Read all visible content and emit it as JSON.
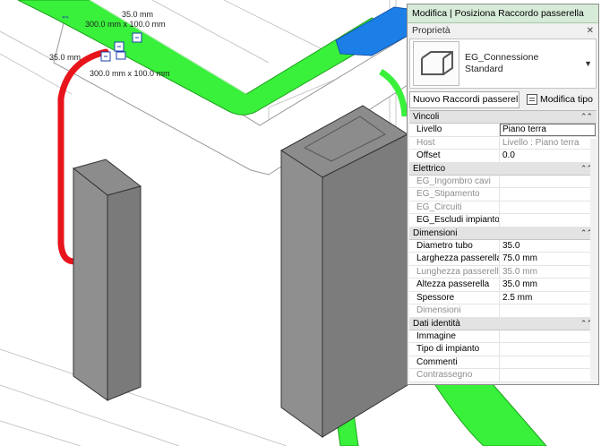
{
  "viewport": {
    "dimensions": [
      "35.0 mm",
      "300.0 mm x 100.0 mm",
      "35.0 mm",
      "300.0 mm x 100.0 mm"
    ]
  },
  "properties_panel": {
    "title": "Modifica | Posiziona Raccordo passerella",
    "section_label": "Proprietà",
    "close_glyph": "✕",
    "type_selector": {
      "family": "EG_Connessione",
      "type": "Standard",
      "caret": "▼"
    },
    "instance_filter": {
      "value": "Nuovo Raccordi passerel",
      "chevron": "⌄"
    },
    "edit_type_label": "Modifica tipo",
    "collapse_glyph": "⌃⌃",
    "groups": [
      {
        "name": "Vincoli",
        "rows": [
          {
            "label": "Livello",
            "value": "Piano terra",
            "disabled": false,
            "editing": true
          },
          {
            "label": "Host",
            "value": "Livello : Piano terra",
            "disabled": true,
            "editing": false
          },
          {
            "label": "Offset",
            "value": "0.0",
            "disabled": false,
            "editing": false
          }
        ]
      },
      {
        "name": "Elettrico",
        "rows": [
          {
            "label": "EG_Ingombro cavi",
            "value": "",
            "disabled": true,
            "editing": false
          },
          {
            "label": "EG_Stipamento",
            "value": "",
            "disabled": true,
            "editing": false
          },
          {
            "label": "EG_Circuiti",
            "value": "",
            "disabled": true,
            "editing": false
          },
          {
            "label": "EG_Escludi impianto",
            "value": "",
            "disabled": false,
            "editing": false
          }
        ]
      },
      {
        "name": "Dimensioni",
        "rows": [
          {
            "label": "Diametro tubo",
            "value": "35.0",
            "disabled": false,
            "editing": false
          },
          {
            "label": "Larghezza passerella",
            "value": "75.0 mm",
            "disabled": false,
            "editing": false
          },
          {
            "label": "Lunghezza passerella",
            "value": "35.0 mm",
            "disabled": true,
            "editing": false
          },
          {
            "label": "Altezza passerella",
            "value": "35.0 mm",
            "disabled": false,
            "editing": false
          },
          {
            "label": "Spessore",
            "value": "2.5 mm",
            "disabled": false,
            "editing": false
          },
          {
            "label": "Dimensioni",
            "value": "",
            "disabled": true,
            "editing": false
          }
        ]
      },
      {
        "name": "Dati identità",
        "rows": [
          {
            "label": "Immagine",
            "value": "",
            "disabled": false,
            "editing": false
          },
          {
            "label": "Tipo di impianto",
            "value": "",
            "disabled": false,
            "editing": false
          },
          {
            "label": "Commenti",
            "value": "",
            "disabled": false,
            "editing": false
          },
          {
            "label": "Contrassegno",
            "value": "",
            "disabled": true,
            "editing": false
          }
        ]
      }
    ]
  }
}
